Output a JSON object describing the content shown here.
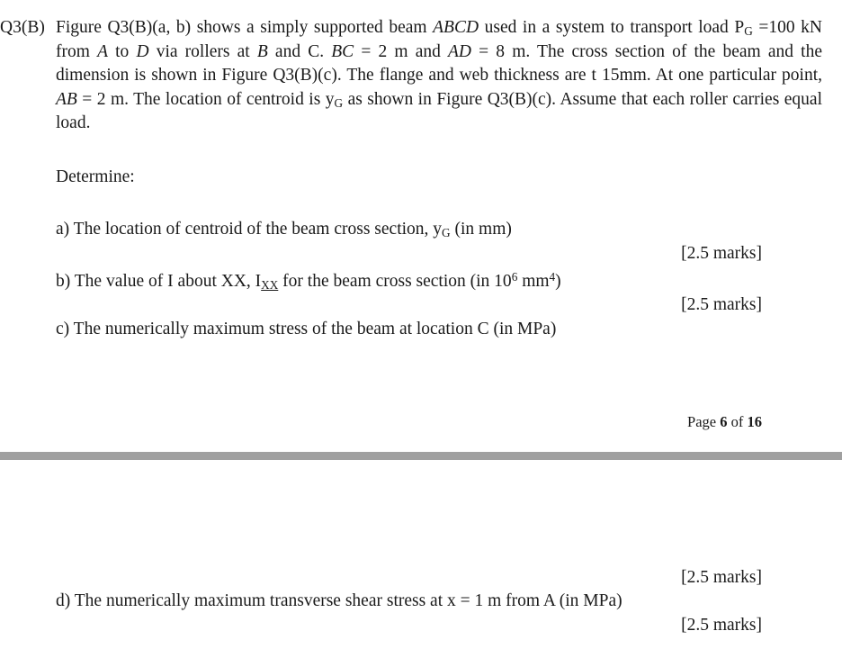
{
  "document": {
    "question_number": "Q3(B)",
    "body_segments": [
      {
        "t": "Figure Q3(B)(a, b) shows a simply supported beam ",
        "style": "normal"
      },
      {
        "t": "ABCD",
        "style": "italic"
      },
      {
        "t": " used in a system to transport load P",
        "style": "normal"
      },
      {
        "t": "G",
        "style": "sub"
      },
      {
        "t": " =100 kN from ",
        "style": "normal"
      },
      {
        "t": "A",
        "style": "italic"
      },
      {
        "t": " to ",
        "style": "normal"
      },
      {
        "t": "D",
        "style": "italic"
      },
      {
        "t": " via rollers at ",
        "style": "normal"
      },
      {
        "t": "B",
        "style": "italic"
      },
      {
        "t": " and C. ",
        "style": "normal"
      },
      {
        "t": "BC",
        "style": "italic"
      },
      {
        "t": " = 2 m and ",
        "style": "normal"
      },
      {
        "t": "AD",
        "style": "italic"
      },
      {
        "t": " = 8 m. The cross section of the beam and the dimension is shown in Figure Q3(B)(c). The flange and web thickness are t 15mm. At one particular point, ",
        "style": "normal"
      },
      {
        "t": "AB",
        "style": "italic"
      },
      {
        "t": " = 2 m. The location of centroid is y",
        "style": "normal"
      },
      {
        "t": "G",
        "style": "sub"
      },
      {
        "t": " as shown in Figure Q3(B)(c). Assume that each roller carries equal load.",
        "style": "normal"
      }
    ],
    "body_plain": "Figure Q3(B)(a, b) shows a simply supported beam ABCD used in a system to transport load PG =100 kN from A to D via rollers at B and C. BC = 2 m and AD = 8 m. The cross section of the beam and the dimension is shown in Figure Q3(B)(c). The flange and web thickness are t 15mm. At one particular point, AB = 2 m. The location of centroid is yG as shown in Figure Q3(B)(c). Assume that each roller carries equal load.",
    "determine_label": "Determine:",
    "sub_questions": [
      {
        "id": "a",
        "prefix": "a) The location of centroid of the beam cross section, y",
        "subscript": "G",
        "suffix": " (in mm)",
        "marks": "[2.5 marks]"
      },
      {
        "id": "b",
        "prefix": "b) The value of I about XX, I",
        "subscript": "XX",
        "mid": " for the beam cross section (in 10",
        "superscript_1": "6",
        "mid2": " mm",
        "superscript_2": "4",
        "suffix": ")",
        "marks": "[2.5 marks]"
      },
      {
        "id": "c",
        "text": "c) The numerically maximum stress of the beam at location C (in MPa)",
        "marks": ""
      },
      {
        "id": "d",
        "text": "d) The numerically maximum transverse shear stress at x = 1 m from A (in MPa)",
        "marks_above": "[2.5 marks]",
        "marks_below": "[2.5 marks]"
      }
    ],
    "footer": {
      "prefix": "Page ",
      "current_page": "6",
      "middle": " of ",
      "total_pages": "16"
    },
    "separator_color": "#a0a0a0"
  }
}
